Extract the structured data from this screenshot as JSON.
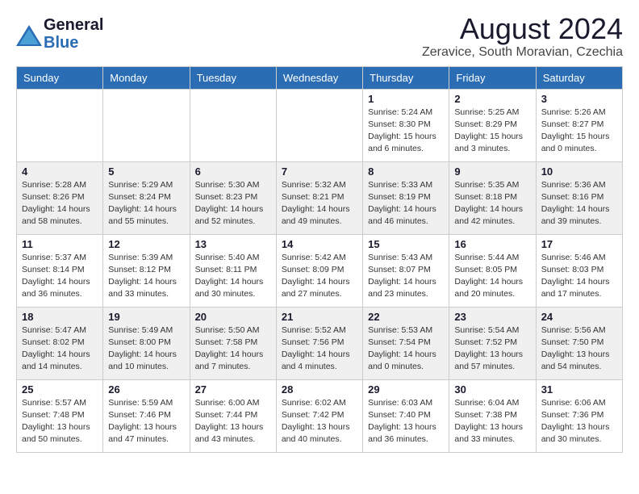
{
  "header": {
    "logo_general": "General",
    "logo_blue": "Blue",
    "month_year": "August 2024",
    "location": "Zeravice, South Moravian, Czechia"
  },
  "weekdays": [
    "Sunday",
    "Monday",
    "Tuesday",
    "Wednesday",
    "Thursday",
    "Friday",
    "Saturday"
  ],
  "weeks": [
    [
      {
        "day": "",
        "info": ""
      },
      {
        "day": "",
        "info": ""
      },
      {
        "day": "",
        "info": ""
      },
      {
        "day": "",
        "info": ""
      },
      {
        "day": "1",
        "info": "Sunrise: 5:24 AM\nSunset: 8:30 PM\nDaylight: 15 hours\nand 6 minutes."
      },
      {
        "day": "2",
        "info": "Sunrise: 5:25 AM\nSunset: 8:29 PM\nDaylight: 15 hours\nand 3 minutes."
      },
      {
        "day": "3",
        "info": "Sunrise: 5:26 AM\nSunset: 8:27 PM\nDaylight: 15 hours\nand 0 minutes."
      }
    ],
    [
      {
        "day": "4",
        "info": "Sunrise: 5:28 AM\nSunset: 8:26 PM\nDaylight: 14 hours\nand 58 minutes."
      },
      {
        "day": "5",
        "info": "Sunrise: 5:29 AM\nSunset: 8:24 PM\nDaylight: 14 hours\nand 55 minutes."
      },
      {
        "day": "6",
        "info": "Sunrise: 5:30 AM\nSunset: 8:23 PM\nDaylight: 14 hours\nand 52 minutes."
      },
      {
        "day": "7",
        "info": "Sunrise: 5:32 AM\nSunset: 8:21 PM\nDaylight: 14 hours\nand 49 minutes."
      },
      {
        "day": "8",
        "info": "Sunrise: 5:33 AM\nSunset: 8:19 PM\nDaylight: 14 hours\nand 46 minutes."
      },
      {
        "day": "9",
        "info": "Sunrise: 5:35 AM\nSunset: 8:18 PM\nDaylight: 14 hours\nand 42 minutes."
      },
      {
        "day": "10",
        "info": "Sunrise: 5:36 AM\nSunset: 8:16 PM\nDaylight: 14 hours\nand 39 minutes."
      }
    ],
    [
      {
        "day": "11",
        "info": "Sunrise: 5:37 AM\nSunset: 8:14 PM\nDaylight: 14 hours\nand 36 minutes."
      },
      {
        "day": "12",
        "info": "Sunrise: 5:39 AM\nSunset: 8:12 PM\nDaylight: 14 hours\nand 33 minutes."
      },
      {
        "day": "13",
        "info": "Sunrise: 5:40 AM\nSunset: 8:11 PM\nDaylight: 14 hours\nand 30 minutes."
      },
      {
        "day": "14",
        "info": "Sunrise: 5:42 AM\nSunset: 8:09 PM\nDaylight: 14 hours\nand 27 minutes."
      },
      {
        "day": "15",
        "info": "Sunrise: 5:43 AM\nSunset: 8:07 PM\nDaylight: 14 hours\nand 23 minutes."
      },
      {
        "day": "16",
        "info": "Sunrise: 5:44 AM\nSunset: 8:05 PM\nDaylight: 14 hours\nand 20 minutes."
      },
      {
        "day": "17",
        "info": "Sunrise: 5:46 AM\nSunset: 8:03 PM\nDaylight: 14 hours\nand 17 minutes."
      }
    ],
    [
      {
        "day": "18",
        "info": "Sunrise: 5:47 AM\nSunset: 8:02 PM\nDaylight: 14 hours\nand 14 minutes."
      },
      {
        "day": "19",
        "info": "Sunrise: 5:49 AM\nSunset: 8:00 PM\nDaylight: 14 hours\nand 10 minutes."
      },
      {
        "day": "20",
        "info": "Sunrise: 5:50 AM\nSunset: 7:58 PM\nDaylight: 14 hours\nand 7 minutes."
      },
      {
        "day": "21",
        "info": "Sunrise: 5:52 AM\nSunset: 7:56 PM\nDaylight: 14 hours\nand 4 minutes."
      },
      {
        "day": "22",
        "info": "Sunrise: 5:53 AM\nSunset: 7:54 PM\nDaylight: 14 hours\nand 0 minutes."
      },
      {
        "day": "23",
        "info": "Sunrise: 5:54 AM\nSunset: 7:52 PM\nDaylight: 13 hours\nand 57 minutes."
      },
      {
        "day": "24",
        "info": "Sunrise: 5:56 AM\nSunset: 7:50 PM\nDaylight: 13 hours\nand 54 minutes."
      }
    ],
    [
      {
        "day": "25",
        "info": "Sunrise: 5:57 AM\nSunset: 7:48 PM\nDaylight: 13 hours\nand 50 minutes."
      },
      {
        "day": "26",
        "info": "Sunrise: 5:59 AM\nSunset: 7:46 PM\nDaylight: 13 hours\nand 47 minutes."
      },
      {
        "day": "27",
        "info": "Sunrise: 6:00 AM\nSunset: 7:44 PM\nDaylight: 13 hours\nand 43 minutes."
      },
      {
        "day": "28",
        "info": "Sunrise: 6:02 AM\nSunset: 7:42 PM\nDaylight: 13 hours\nand 40 minutes."
      },
      {
        "day": "29",
        "info": "Sunrise: 6:03 AM\nSunset: 7:40 PM\nDaylight: 13 hours\nand 36 minutes."
      },
      {
        "day": "30",
        "info": "Sunrise: 6:04 AM\nSunset: 7:38 PM\nDaylight: 13 hours\nand 33 minutes."
      },
      {
        "day": "31",
        "info": "Sunrise: 6:06 AM\nSunset: 7:36 PM\nDaylight: 13 hours\nand 30 minutes."
      }
    ]
  ]
}
